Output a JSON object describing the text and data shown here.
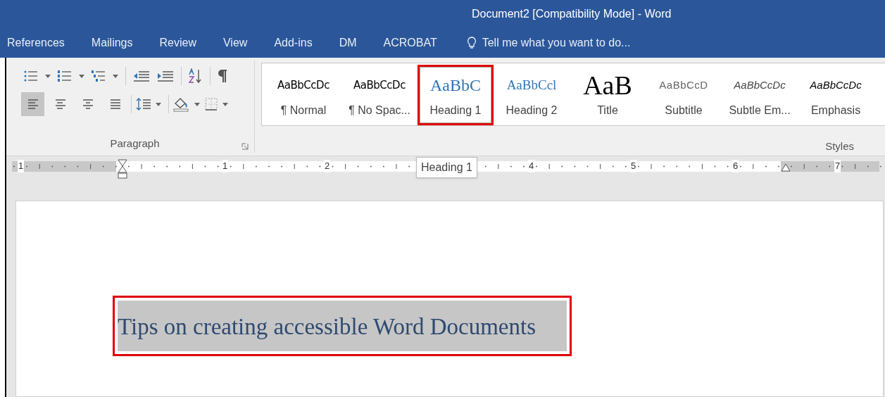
{
  "window": {
    "title": "Document2 [Compatibility Mode] - Word"
  },
  "ribbon_tabs": [
    "References",
    "Mailings",
    "Review",
    "View",
    "Add-ins",
    "DM",
    "ACROBAT"
  ],
  "tell_me": {
    "placeholder": "Tell me what you want to do..."
  },
  "paragraph_group": {
    "label": "Paragraph",
    "alignment": [
      {
        "kind": "left",
        "selected": true
      },
      {
        "kind": "center",
        "selected": false
      },
      {
        "kind": "right",
        "selected": false
      },
      {
        "kind": "justify",
        "selected": false
      }
    ]
  },
  "styles_group": {
    "label": "Styles",
    "styles": [
      {
        "preview": "AaBbCcDc",
        "name": "¶ Normal",
        "kind": "normal",
        "selected": false
      },
      {
        "preview": "AaBbCcDc",
        "name": "¶ No Spac...",
        "kind": "normal",
        "selected": false
      },
      {
        "preview": "AaBbC",
        "name": "Heading 1",
        "kind": "heading1",
        "selected": true
      },
      {
        "preview": "AaBbCcl",
        "name": "Heading 2",
        "kind": "heading2",
        "selected": false
      },
      {
        "preview": "AaB",
        "name": "Title",
        "kind": "title",
        "selected": false
      },
      {
        "preview": "AaBbCcD",
        "name": "Subtitle",
        "kind": "subtitle",
        "selected": false
      },
      {
        "preview": "AaBbCcDc",
        "name": "Subtle Em...",
        "kind": "subtle",
        "selected": false
      },
      {
        "preview": "AaBbCcDc",
        "name": "Emphasis",
        "kind": "emphasis",
        "selected": false
      }
    ]
  },
  "ruler": {
    "labels": [
      "1",
      "1",
      "2",
      "4",
      "5",
      "6",
      "7"
    ]
  },
  "tooltip": "Heading 1",
  "document": {
    "heading": "Tips on creating accessible Word Documents"
  }
}
